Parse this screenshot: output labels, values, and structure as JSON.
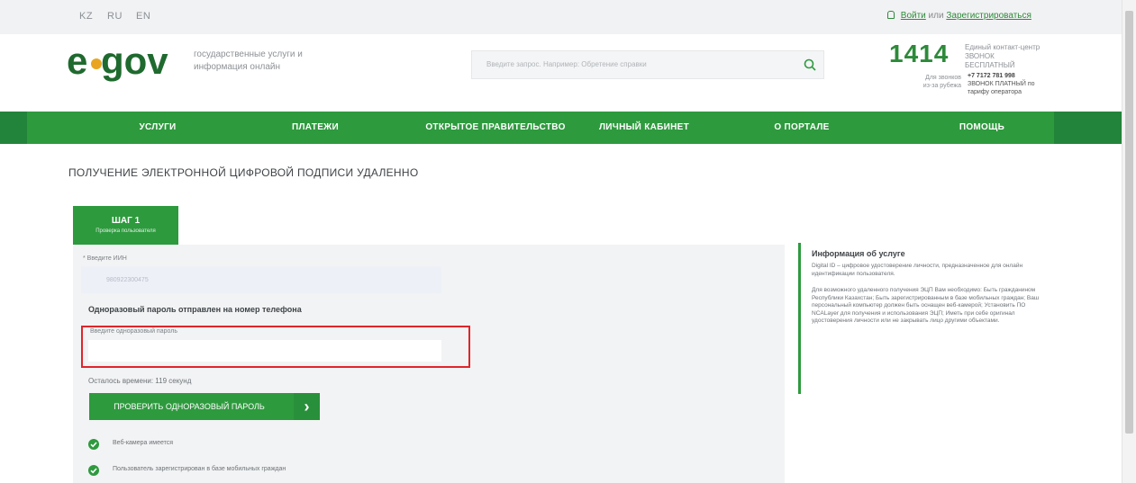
{
  "top": {
    "langs": [
      "KZ",
      "RU",
      "EN"
    ],
    "login": "Войти",
    "or": "или",
    "register": "Зарегистрироваться"
  },
  "header": {
    "tagline": "государственные услуги и информация онлайн",
    "search_placeholder": "Введите запрос. Например: Обретение справки",
    "phone": "1414",
    "phone_note": "Единый контакт-центр ЗВОНОК БЕСПЛАТНЫЙ",
    "abroad_label": "Для звонков из-за рубежа",
    "abroad_number": "+7 7172 781 998",
    "abroad_note": "ЗВОНОК ПЛАТНЫЙ по тарифу оператора"
  },
  "nav": [
    "УСЛУГИ",
    "ПЛАТЕЖИ",
    "ОТКРЫТОЕ ПРАВИТЕЛЬСТВО",
    "ЛИЧНЫЙ КАБИНЕТ",
    "О ПОРТАЛЕ",
    "ПОМОЩЬ"
  ],
  "page": {
    "title": "ПОЛУЧЕНИЕ ЭЛЕКТРОННОЙ ЦИФРОВОЙ ПОДПИСИ УДАЛЕННО"
  },
  "step": {
    "title": "ШАГ 1",
    "subtitle": "Проверка пользователя"
  },
  "form": {
    "iin_label": "* Введите ИИН",
    "iin_value": "980922300475",
    "otp_sent": "Одноразовый пароль отправлен на номер телефона",
    "otp_label": "Введите одноразовый пароль",
    "otp_value": "",
    "time_left": "Осталось времени: 119 секунд",
    "verify_button": "ПРОВЕРИТЬ ОДНОРАЗОВЫЙ ПАРОЛЬ",
    "verify_arrow": "›",
    "checks": [
      "Веб-камера имеется",
      "Пользователь зарегистрирован в базе мобильных граждан"
    ]
  },
  "info": {
    "title": "Информация об услуге",
    "p1": "Digital ID – цифровое удостоверение личности, предназначенное для онлайн идентификации пользователя.",
    "p2": "Для возможного удаленного получения ЭЦП Вам необходимо: Быть гражданином Республики Казахстан; Быть зарегистрированным в базе мобильных граждан; Ваш персональный компьютер должен быть оснащен веб-камерой; Установить ПО NCALayer для получения и использования ЭЦП; Иметь при себе оригинал удостоверения личности или не закрывать лицо другими объектами."
  },
  "colors": {
    "green": "#2e9a3e",
    "dark_green": "#1f6a2e",
    "highlight": "#e0252b"
  }
}
